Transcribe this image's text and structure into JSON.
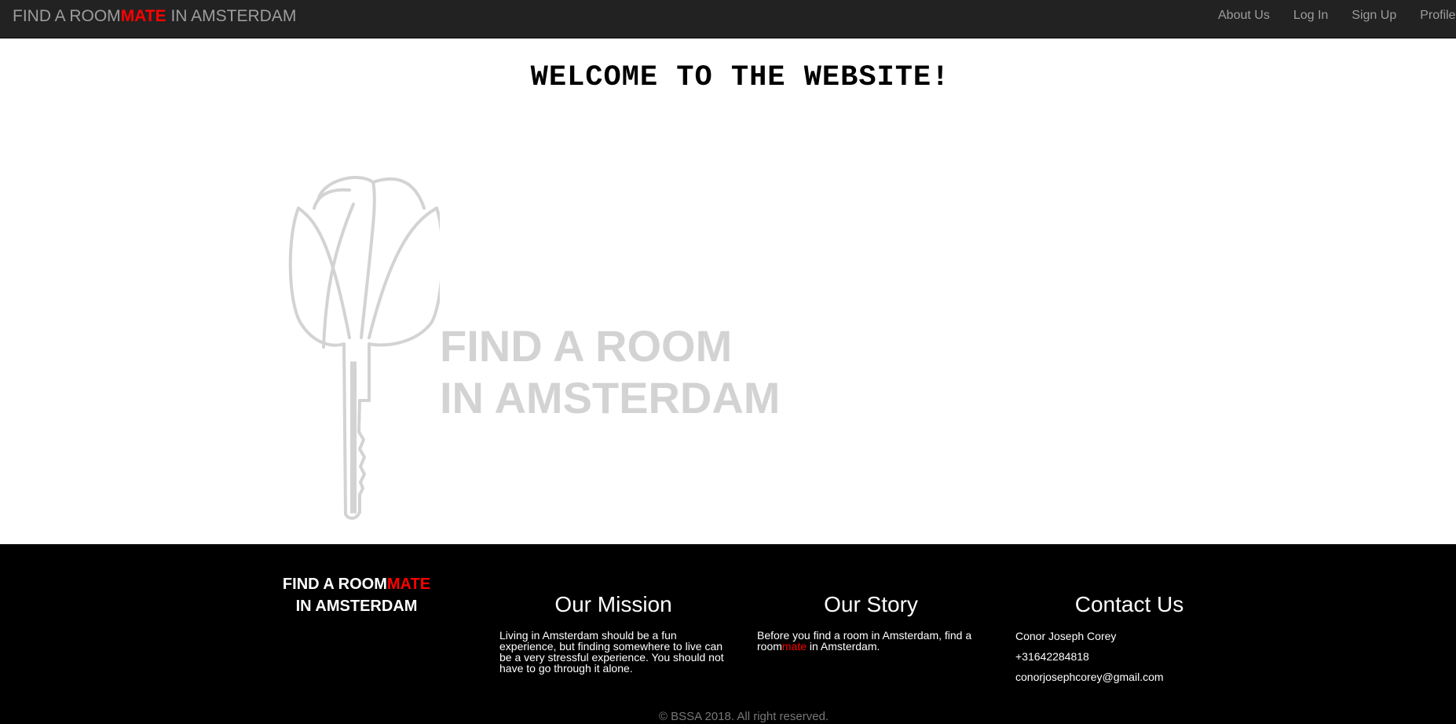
{
  "navbar": {
    "brand_prefix": "FIND A ROOM",
    "brand_accent": "MATE",
    "brand_suffix": " IN AMSTERDAM",
    "links": [
      "About Us",
      "Log In",
      "Sign Up",
      "Profile"
    ]
  },
  "main": {
    "welcome_title": "WELCOME TO THE WEBSITE!",
    "hero_line1": "FIND A ROOM",
    "hero_line2": "IN AMSTERDAM",
    "hero_icon": "tulip-key-logo"
  },
  "footer": {
    "brand_prefix": "FIND A ROOM",
    "brand_accent": "MATE",
    "brand_line2": "IN AMSTERDAM",
    "mission": {
      "title": "Our Mission",
      "text": "Living in Amsterdam should be a fun experience, but finding somewhere to live can be a very stressful experience. You should not have to go through it alone."
    },
    "story": {
      "title": "Our Story",
      "text_before": "Before you find a room in Amsterdam, find a room",
      "text_accent": "mate",
      "text_after": " in Amsterdam."
    },
    "contact": {
      "title": "Contact Us",
      "name": "Conor Joseph Corey",
      "phone": "+31642284818",
      "email": "conorjosephcorey@gmail.com"
    },
    "copyright": "© BSSA 2018. All right reserved."
  },
  "colors": {
    "navbar_bg": "#222222",
    "nav_text": "#9d9d9d",
    "accent": "#ff0000",
    "footer_bg": "#000000",
    "hero_gray": "#d3d3d3"
  }
}
